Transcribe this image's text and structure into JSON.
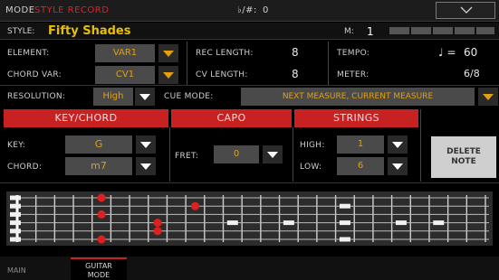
{
  "topbar": {
    "mode_label": "MODE",
    "mode_value": "STYLE RECORD",
    "key_tempo_label": "♭/#:",
    "key_tempo_value": "0",
    "menu_icon": "chevron-down-icon"
  },
  "style": {
    "label": "STYLE:",
    "name": "Fifty Shades",
    "measure_label": "M:",
    "measure_value": "1"
  },
  "element": {
    "label": "ELEMENT:",
    "value": "VAR1"
  },
  "chord_var": {
    "label": "CHORD VAR:",
    "value": "CV1"
  },
  "rec_length": {
    "label": "REC LENGTH:",
    "value": "8"
  },
  "cv_length": {
    "label": "CV LENGTH:",
    "value": "8"
  },
  "tempo": {
    "label": "TEMPO:",
    "symbol": "♩ =",
    "value": "60"
  },
  "meter": {
    "label": "METER:",
    "value": "6/8"
  },
  "resolution": {
    "label": "RESOLUTION:",
    "value": "High"
  },
  "cue_mode": {
    "label": "CUE MODE:",
    "value": "NEXT MEASURE, CURRENT MEASURE"
  },
  "key_chord": {
    "header": "KEY/CHORD",
    "key_label": "KEY:",
    "key_value": "G",
    "chord_label": "CHORD:",
    "chord_value": "m7"
  },
  "capo": {
    "header": "CAPO",
    "fret_label": "FRET:",
    "fret_value": "0"
  },
  "strings": {
    "header": "STRINGS",
    "high_label": "HIGH:",
    "high_value": "1",
    "low_label": "LOW:",
    "low_value": "6"
  },
  "delete_button": {
    "line1": "DELETE",
    "line2": "NOTE"
  },
  "fretboard": {
    "frets": 25,
    "strings": 6,
    "red_notes": [
      {
        "string": 1,
        "fret": 5
      },
      {
        "string": 3,
        "fret": 5
      },
      {
        "string": 6,
        "fret": 5
      },
      {
        "string": 2,
        "fret": 10
      },
      {
        "string": 4,
        "fret": 8
      },
      {
        "string": 5,
        "fret": 8
      }
    ],
    "white_notes": [
      {
        "string": 1,
        "fret": 0
      },
      {
        "string": 2,
        "fret": 0
      },
      {
        "string": 3,
        "fret": 0
      },
      {
        "string": 4,
        "fret": 0
      },
      {
        "string": 5,
        "fret": 0
      },
      {
        "string": 6,
        "fret": 0
      },
      {
        "string": 4,
        "fret": 12
      },
      {
        "string": 4,
        "fret": 15
      },
      {
        "string": 2,
        "fret": 18
      },
      {
        "string": 4,
        "fret": 18
      },
      {
        "string": 6,
        "fret": 18
      },
      {
        "string": 4,
        "fret": 21
      },
      {
        "string": 4,
        "fret": 23
      }
    ],
    "colors": {
      "red": "#e02020",
      "white": "#f0f0f0"
    }
  },
  "tabs": {
    "main": "MAIN",
    "guitar_line1": "GUITAR",
    "guitar_line2": "MODE"
  }
}
